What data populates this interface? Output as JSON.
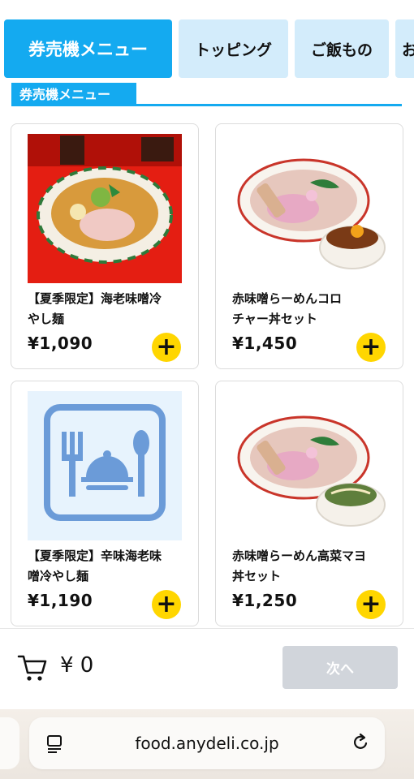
{
  "tabs": [
    {
      "label": "券売機メニュー",
      "active": true
    },
    {
      "label": "トッピング",
      "active": false
    },
    {
      "label": "ご飯もの",
      "active": false
    },
    {
      "label": "お",
      "active": false
    }
  ],
  "section": {
    "title": "券売機メニュー"
  },
  "products": [
    {
      "name": "【夏季限定】海老味噌冷やし麺",
      "name_lines": [
        "【夏季限定】海老味噌冷",
        "やし麺"
      ],
      "price": "¥1,090",
      "image_icon": "ramen-bowl-photo-icon"
    },
    {
      "name": "赤味噌らーめんコロチャー丼セット",
      "name_lines": [
        "赤味噌らーめんコロ",
        "チャー丼セット"
      ],
      "price": "¥1,450",
      "image_icon": "ramen-chashu-don-photo-icon"
    },
    {
      "name": "【夏季限定】辛味海老味噌冷やし麺",
      "name_lines": [
        "【夏季限定】辛味海老味",
        "噌冷やし麺"
      ],
      "price": "¥1,190",
      "image_icon": "meal-placeholder-icon"
    },
    {
      "name": "赤味噌らーめん高菜マヨ丼セット",
      "name_lines": [
        "赤味噌らーめん高菜マヨ",
        "丼セット"
      ],
      "price": "¥1,250",
      "image_icon": "ramen-takana-don-photo-icon"
    }
  ],
  "add_button_label": "+",
  "cart": {
    "total": "¥ 0",
    "next_label": "次へ"
  },
  "browser": {
    "url": "food.anydeli.co.jp"
  },
  "colors": {
    "accent": "#14aaf0",
    "tab_inactive": "#d3ecfb",
    "add_button": "#ffd600",
    "disabled_button": "#d1d5db"
  }
}
